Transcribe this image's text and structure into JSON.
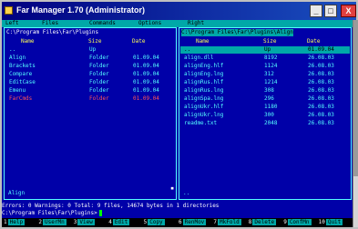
{
  "window": {
    "title": "Far Manager 1.70 (Administrator)",
    "min": "_",
    "max": "□",
    "close": "X"
  },
  "menu": [
    "Left",
    "Files",
    "Commands",
    "Options",
    "Right"
  ],
  "left_panel": {
    "path": "C:\\Program Files\\Far\\Plugins",
    "headers": [
      "Name",
      "Size",
      "Date"
    ],
    "rows": [
      {
        "name": "..",
        "size": "Up",
        "date": "",
        "style": "dim"
      },
      {
        "name": "Align",
        "size": "Folder",
        "date": "01.09.04",
        "style": "normal"
      },
      {
        "name": "Brackets",
        "size": "Folder",
        "date": "01.09.04",
        "style": "normal"
      },
      {
        "name": "Compare",
        "size": "Folder",
        "date": "01.09.04",
        "style": "normal"
      },
      {
        "name": "EditCase",
        "size": "Folder",
        "date": "01.09.04",
        "style": "normal"
      },
      {
        "name": "Emenu",
        "size": "Folder",
        "date": "01.09.04",
        "style": "normal"
      },
      {
        "name": "FarCmds",
        "size": "Folder",
        "date": "01.09.04",
        "style": "red"
      }
    ],
    "footer": "Align"
  },
  "right_panel": {
    "path": "C:\\Program Files\\Far\\Plugins\\Align",
    "headers": [
      "Name",
      "Size",
      "Date"
    ],
    "rows": [
      {
        "name": "..",
        "size": "Up",
        "date": "01.09.04",
        "style": "sel"
      },
      {
        "name": "align.dll",
        "size": "8192",
        "date": "26.08.03",
        "style": "normal"
      },
      {
        "name": "alignEng.hlf",
        "size": "1124",
        "date": "26.08.03",
        "style": "normal"
      },
      {
        "name": "alignEng.lng",
        "size": "312",
        "date": "26.08.03",
        "style": "normal"
      },
      {
        "name": "alignRus.hlf",
        "size": "1214",
        "date": "26.08.03",
        "style": "normal"
      },
      {
        "name": "alignRus.lng",
        "size": "308",
        "date": "26.08.03",
        "style": "normal"
      },
      {
        "name": "alignSpa.lng",
        "size": "296",
        "date": "26.08.03",
        "style": "normal"
      },
      {
        "name": "alignUkr.hlf",
        "size": "1180",
        "date": "26.08.03",
        "style": "normal"
      },
      {
        "name": "alignUkr.lng",
        "size": "300",
        "date": "26.08.03",
        "style": "normal"
      },
      {
        "name": "readme.txt",
        "size": "2048",
        "date": "26.08.03",
        "style": "normal"
      }
    ],
    "footer": ".."
  },
  "command_line": "Errors: 0 Warnings: 0 Total: 9 files, 14674 bytes in 1 directories",
  "prompt": "C:\\Program Files\\Far\\Plugins>",
  "fkeys": [
    {
      "num": "1",
      "label": "Help"
    },
    {
      "num": "2",
      "label": "UserMn"
    },
    {
      "num": "3",
      "label": "View"
    },
    {
      "num": "4",
      "label": "Edit"
    },
    {
      "num": "5",
      "label": "Copy"
    },
    {
      "num": "6",
      "label": "RenMov"
    },
    {
      "num": "7",
      "label": "MkFold"
    },
    {
      "num": "8",
      "label": "Delete"
    },
    {
      "num": "9",
      "label": "ConfMn"
    },
    {
      "num": "10",
      "label": "Quit"
    }
  ]
}
